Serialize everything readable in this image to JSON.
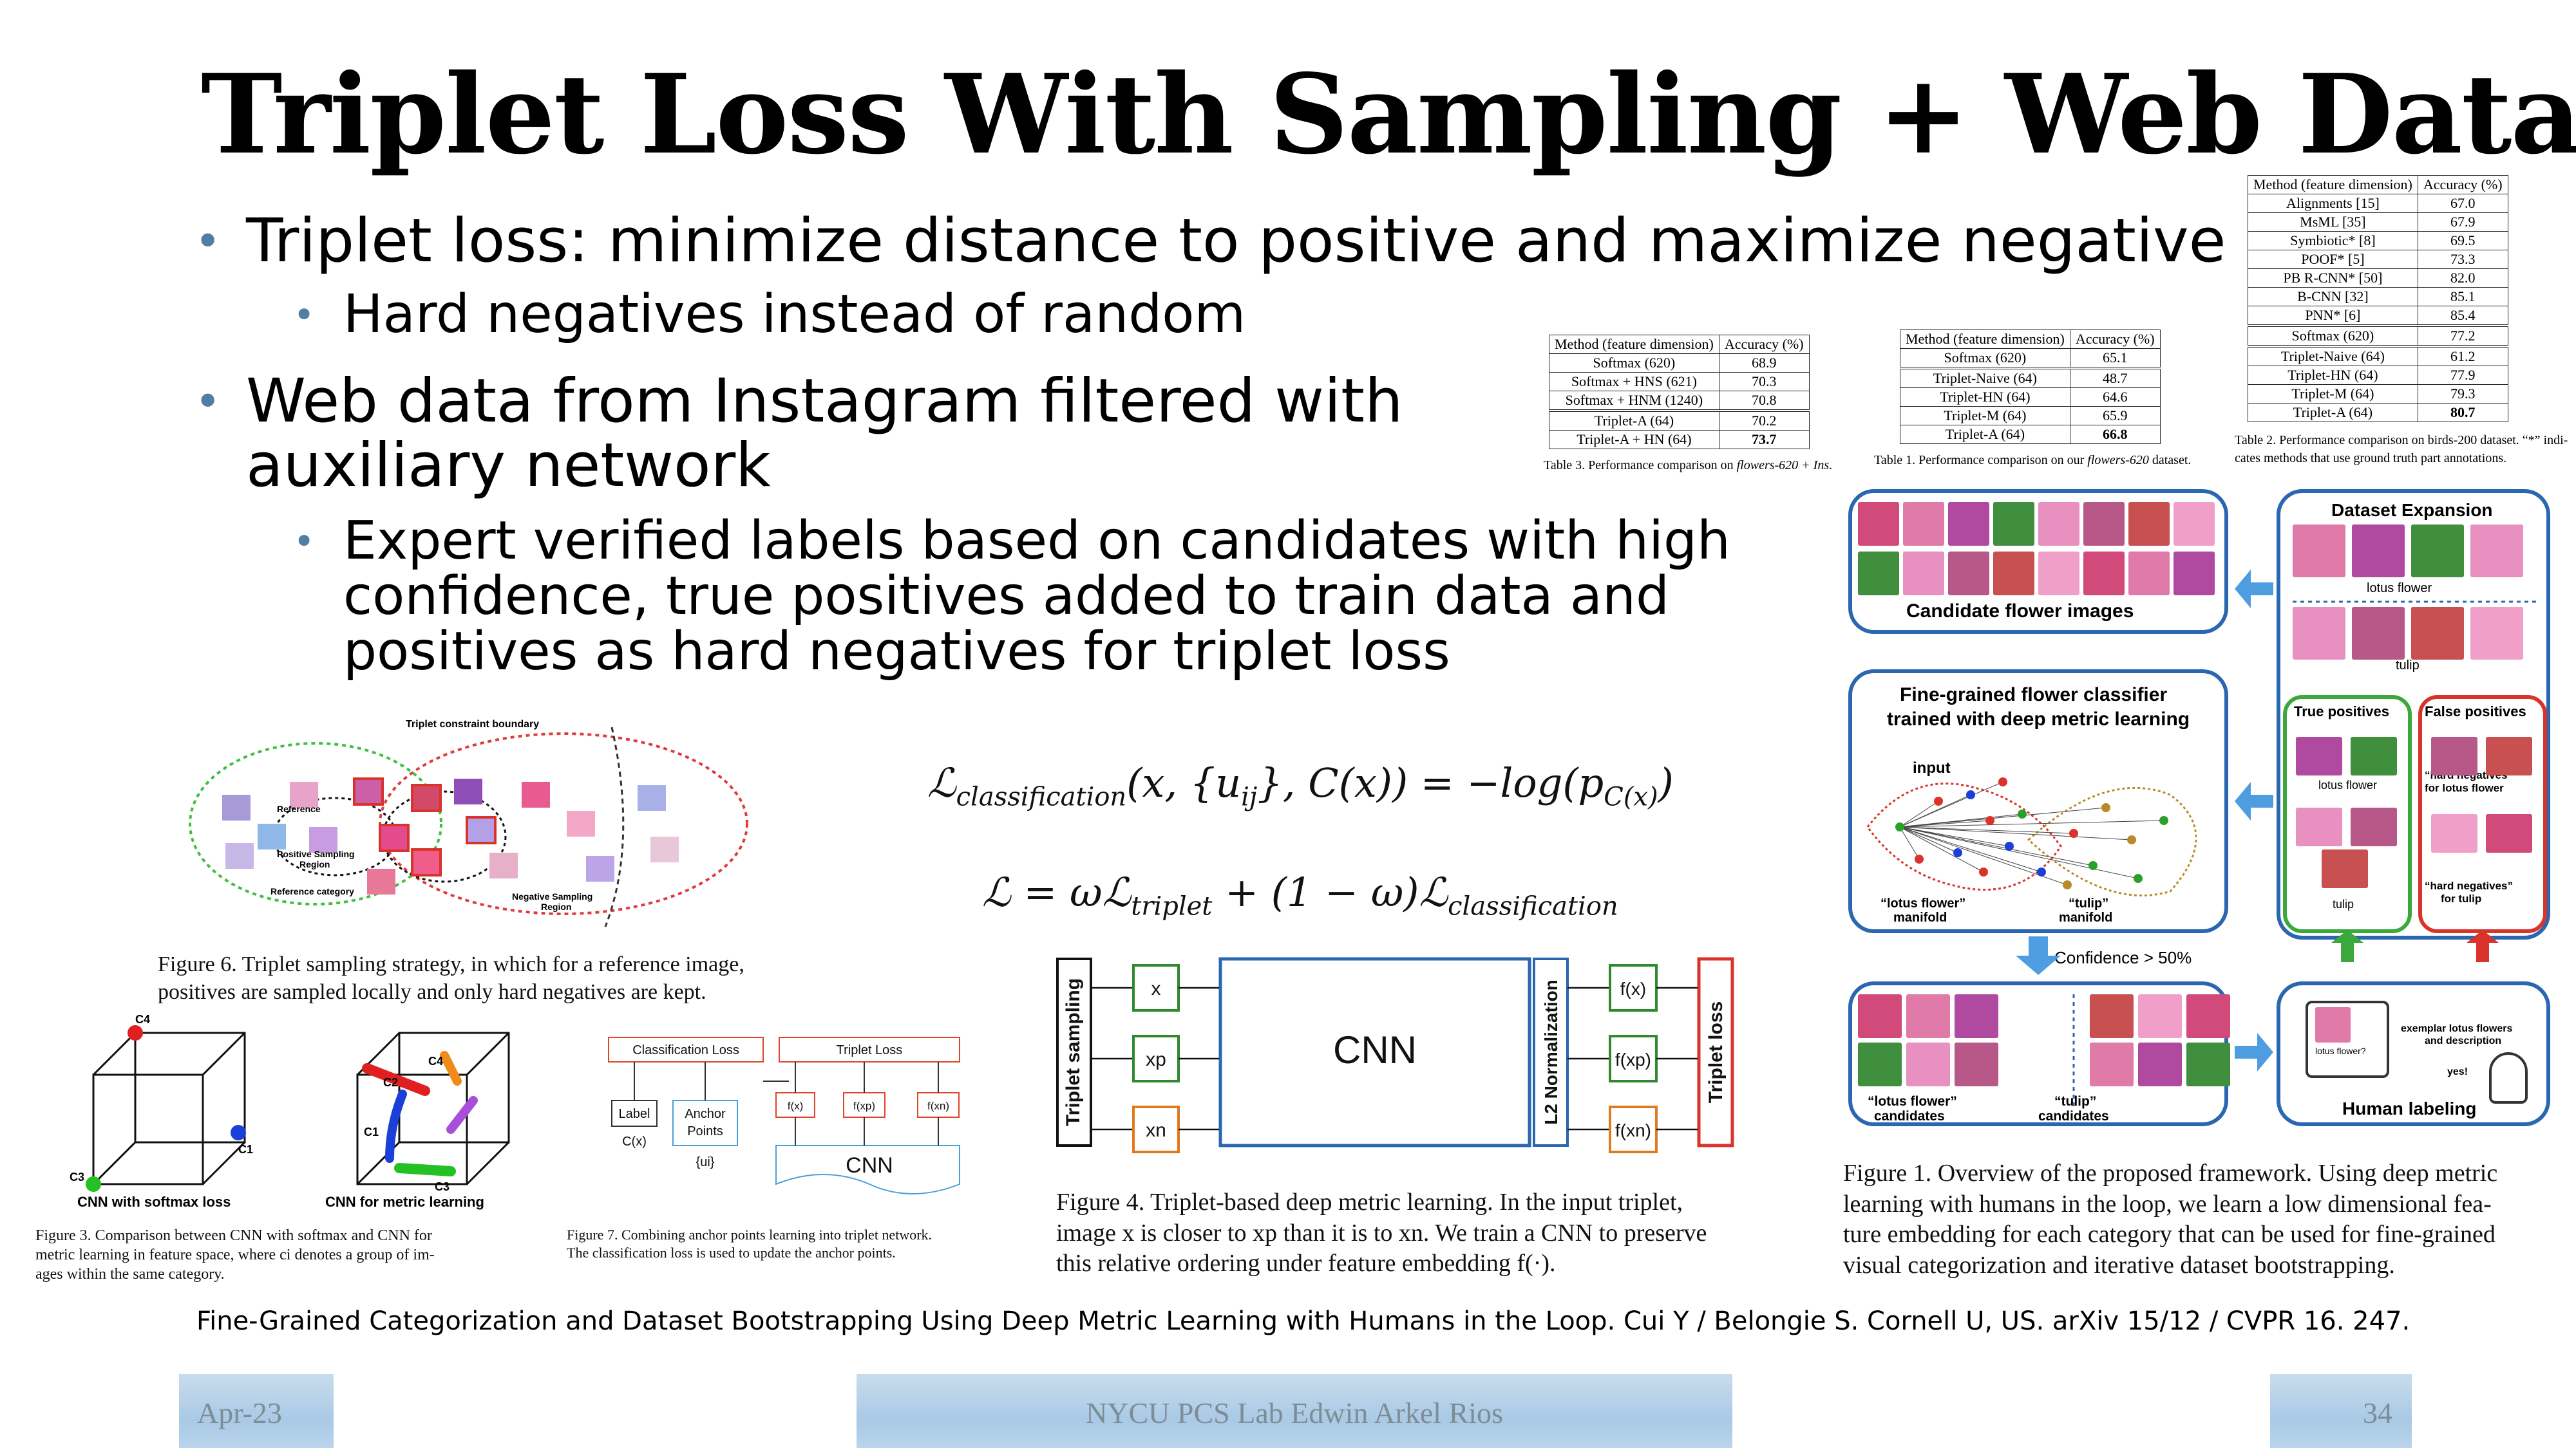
{
  "slide": {
    "title": "Triplet Loss With Sampling + Web Data",
    "bullets": [
      {
        "text": "Triplet loss: minimize distance to positive and maximize negative"
      },
      {
        "text": "Hard negatives instead of random"
      },
      {
        "text_line1": "Web data from Instagram filtered with",
        "text_line2": "auxiliary network"
      },
      {
        "text_line1": "Expert verified labels based on candidates with high",
        "text_line2": "confidence, true positives added to train data and",
        "text_line3": "positives as hard negatives for triplet loss"
      }
    ],
    "citation": "Fine-Grained Categorization and Dataset Bootstrapping Using Deep Metric Learning with Humans in the Loop. Cui Y / Belongie S. Cornell U, US. arXiv 15/12 / CVPR 16. 247.",
    "footer": {
      "date": "Apr-23",
      "center": "NYCU PCS Lab Edwin Arkel Rios",
      "page": "34"
    }
  },
  "tables": {
    "table3": {
      "headers": [
        "Method (feature dimension)",
        "Accuracy (%)"
      ],
      "rows": [
        [
          "Softmax (620)",
          "68.9"
        ],
        [
          "Softmax + HNS (621)",
          "70.3"
        ],
        [
          "Softmax + HNM (1240)",
          "70.8"
        ],
        [
          "Triplet-A (64)",
          "70.2"
        ],
        [
          "Triplet-A + HN (64)",
          "73.7"
        ]
      ],
      "caption_a": "Table 3. Performance comparison on ",
      "caption_em": "flowers-620 + Ins",
      "caption_b": "."
    },
    "table1": {
      "headers": [
        "Method (feature dimension)",
        "Accuracy (%)"
      ],
      "rows": [
        [
          "Softmax (620)",
          "65.1"
        ],
        [
          "Triplet-Naive (64)",
          "48.7"
        ],
        [
          "Triplet-HN (64)",
          "64.6"
        ],
        [
          "Triplet-M (64)",
          "65.9"
        ],
        [
          "Triplet-A (64)",
          "66.8"
        ]
      ],
      "caption_a": "Table 1. Performance comparison on our ",
      "caption_em": "flowers-620",
      "caption_b": " dataset."
    },
    "table2": {
      "headers": [
        "Method (feature dimension)",
        "Accuracy (%)"
      ],
      "rows": [
        [
          "Alignments [15]",
          "67.0"
        ],
        [
          "MsML [35]",
          "67.9"
        ],
        [
          "Symbiotic* [8]",
          "69.5"
        ],
        [
          "POOF* [5]",
          "73.3"
        ],
        [
          "PB R-CNN* [50]",
          "82.0"
        ],
        [
          "B-CNN [32]",
          "85.1"
        ],
        [
          "PNN* [6]",
          "85.4"
        ],
        [
          "Softmax (620)",
          "77.2"
        ],
        [
          "Triplet-Naive (64)",
          "61.2"
        ],
        [
          "Triplet-HN (64)",
          "77.9"
        ],
        [
          "Triplet-M (64)",
          "79.3"
        ],
        [
          "Triplet-A (64)",
          "80.7"
        ]
      ],
      "caption_line1": "Table 2. Performance comparison on birds-200 dataset. “*” indi-",
      "caption_line2": "cates methods that use ground truth part annotations."
    }
  },
  "figure6": {
    "boundary": "Triplet constraint boundary",
    "reference": "Reference",
    "positive_region": "Positive Sampling",
    "positive_region2": "Region",
    "reference_category": "Reference category",
    "negative_region": "Negative Sampling",
    "negative_region2": "Region",
    "caption_line1": "Figure 6. Triplet sampling strategy, in which for a reference image,",
    "caption_line2": "positives are sampled locally and only hard negatives are kept."
  },
  "figure3": {
    "left_label": "CNN with softmax loss",
    "right_label": "CNN for metric learning",
    "c1": "C1",
    "c2": "C2",
    "c3": "C3",
    "c4": "C4",
    "caption_line1": "Figure 3. Comparison between CNN with softmax and CNN for",
    "caption_line2": "metric learning in feature space, where ci denotes a group of im-",
    "caption_line3": "ages within the same category."
  },
  "figure7": {
    "classification_loss": "Classification Loss",
    "triplet_loss": "Triplet Loss",
    "label": "Label",
    "cx": "C(x)",
    "anchor1": "Anchor",
    "anchor2": "Points",
    "ui": "{ui}",
    "fx": "f(x)",
    "fxp": "f(xp)",
    "fxn": "f(xn)",
    "cnn": "CNN",
    "caption_line1": "Figure 7. Combining anchor points learning into triplet network.",
    "caption_line2": "The classification loss is used to update the anchor points."
  },
  "equations": {
    "eq1": "ℒclassification(x, {uij}, C(x)) = −log(pC(x))",
    "eq2": "ℒ = ωℒtriplet + (1 − ω)ℒclassification"
  },
  "figure4": {
    "sampling": "Triplet sampling",
    "x": "x",
    "xp": "xp",
    "xn": "xn",
    "cnn": "CNN",
    "l2": "L2 Normalization",
    "fx": "f(x)",
    "fxp": "f(xp)",
    "fxn": "f(xn)",
    "loss": "Triplet loss",
    "caption_line1": "Figure 4. Triplet-based deep metric learning. In the input triplet,",
    "caption_line2": "image x is closer to xp than it is to xn. We train a CNN to preserve",
    "caption_line3": "this relative ordering under feature embedding f(·)."
  },
  "figure1": {
    "candidate": "Candidate flower images",
    "classifier1": "Fine-grained flower classifier",
    "classifier2": "trained with deep metric learning",
    "input": "input",
    "lotus_manifold1": "“lotus flower”",
    "lotus_manifold2": "manifold",
    "tulip_manifold1": "“tulip”",
    "tulip_manifold2": "manifold",
    "confidence": "Confidence > 50%",
    "lotus_cand1": "“lotus flower”",
    "lotus_cand2": "candidates",
    "tulip_cand1": "“tulip”",
    "tulip_cand2": "candidates",
    "dataset_expansion": "Dataset Expansion",
    "lotus_flower": "lotus flower",
    "tulip": "tulip",
    "true_positives": "True positives",
    "false_positives": "False positives",
    "hard_neg_lotus1": "“hard negatives”",
    "hard_neg_lotus2": "for lotus flower",
    "hard_neg_tulip1": "“hard negatives”",
    "hard_neg_tulip2": "for tulip",
    "human_labeling": "Human labeling",
    "exemplar1": "exemplar lotus flowers",
    "exemplar2": "and description",
    "question": "lotus flower?",
    "yes": "yes!",
    "ellipsis": "...",
    "caption_line1": "Figure 1. Overview of the proposed framework. Using deep metric",
    "caption_line2": "learning with humans in the loop, we learn a low dimensional fea-",
    "caption_line3": "ture embedding for each category that can be used for fine-grained",
    "caption_line4": "visual categorization and iterative dataset bootstrapping."
  },
  "colors": {
    "bullet": "#4f7fa7",
    "blue": "#2b67b0",
    "green": "#3aa83a",
    "red": "#d9342b",
    "orange": "#e07a1f",
    "arrow": "#4d9de0"
  }
}
